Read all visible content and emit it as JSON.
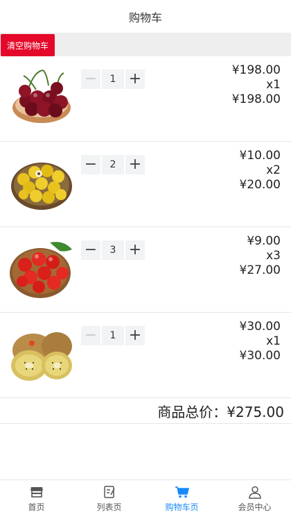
{
  "header": {
    "title": "购物车"
  },
  "toolbar": {
    "clear_label": "清空购物车"
  },
  "items": [
    {
      "name": "cherries",
      "qty": "1",
      "minus_disabled": true,
      "unit_price": "¥198.00",
      "qty_label": "x1",
      "subtotal": "¥198.00"
    },
    {
      "name": "yellow-plums",
      "qty": "2",
      "minus_disabled": false,
      "unit_price": "¥10.00",
      "qty_label": "x2",
      "subtotal": "¥20.00"
    },
    {
      "name": "tomatoes",
      "qty": "3",
      "minus_disabled": false,
      "unit_price": "¥9.00",
      "qty_label": "x3",
      "subtotal": "¥27.00"
    },
    {
      "name": "kiwifruit",
      "qty": "1",
      "minus_disabled": true,
      "unit_price": "¥30.00",
      "qty_label": "x1",
      "subtotal": "¥30.00"
    }
  ],
  "summary": {
    "total_label": "商品总价：¥275.00"
  },
  "tabbar": {
    "tabs": [
      {
        "label": "首页",
        "icon": "shop-icon"
      },
      {
        "label": "列表页",
        "icon": "edit-list-icon"
      },
      {
        "label": "购物车页",
        "icon": "cart-icon",
        "active": true
      },
      {
        "label": "会员中心",
        "icon": "user-icon"
      }
    ],
    "active_color": "#1989fa"
  },
  "colors": {
    "accent_red": "#e4092a",
    "toolbar_bg": "#eeeeee",
    "stepper_bg": "#f2f3f5"
  }
}
